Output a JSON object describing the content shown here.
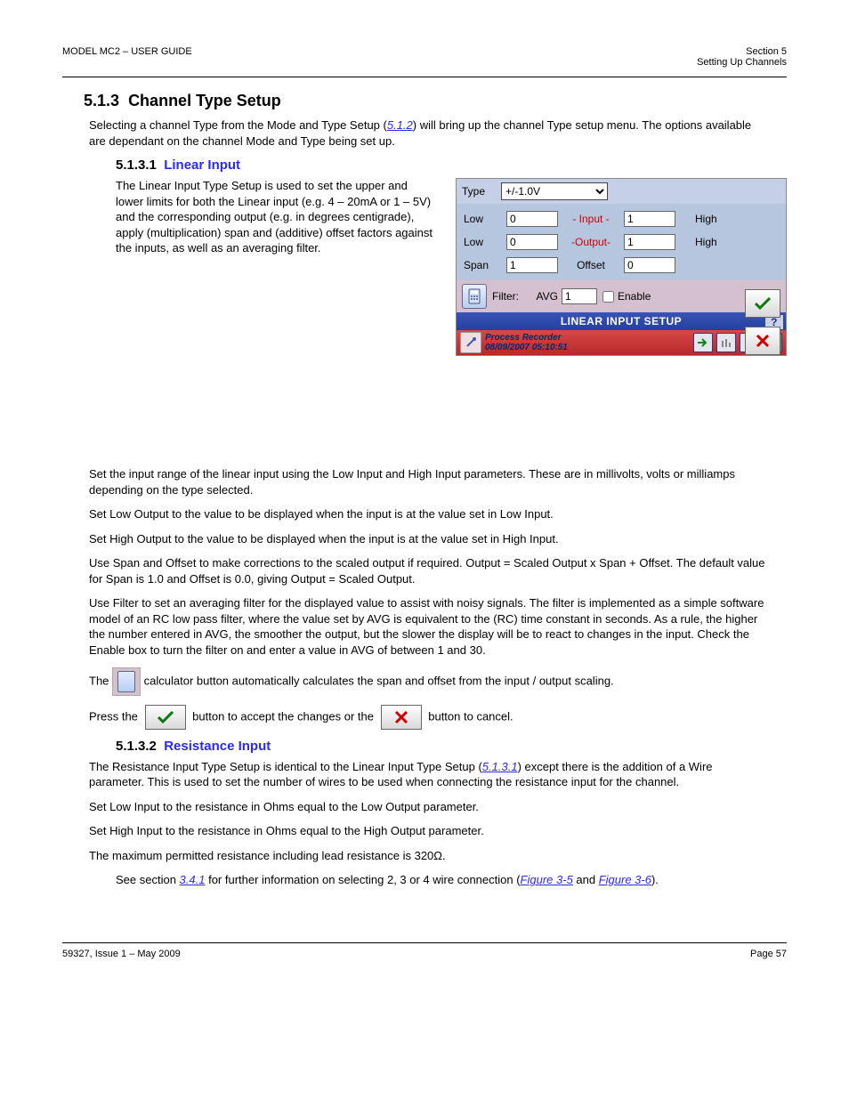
{
  "header": {
    "left": "MODEL MC2 – USER GUIDE",
    "right_line1": "Section 5",
    "right_line2": "Setting Up Channels"
  },
  "section": {
    "num": "5.1.3",
    "title": "Channel Type Setup"
  },
  "pretext": "Selecting a channel Type from the Mode and Type Setup (",
  "pretext_ref": "5.1.2",
  "pretext_after": ") will bring up the channel Type setup menu. The options available are dependant on the channel Mode and Type being set up.",
  "sub1": {
    "num": "5.1.3.1",
    "title": "Linear Input"
  },
  "linear_block": "The Linear Input Type Setup is used to set the upper and lower limits for both the Linear input (e.g. 4 – 20mA or 1 – 5V) and the corresponding output (e.g. in degrees centigrade), apply (multiplication) span and (additive) offset factors against the inputs, as well as an averaging filter.",
  "panel": {
    "type_label": "Type",
    "type_value": "+/-1.0V",
    "rows": [
      {
        "left": "Low",
        "v1": "0",
        "mid": "- Input -",
        "mid_red": true,
        "v2": "1",
        "right": "High"
      },
      {
        "left": "Low",
        "v1": "0",
        "mid": "-Output-",
        "mid_red": true,
        "v2": "1",
        "right": "High"
      },
      {
        "left": "Span",
        "v1": "1",
        "mid": "Offset",
        "mid_red": false,
        "v2": "0",
        "right": ""
      }
    ],
    "filter_label": "Filter:",
    "filter_avg_label": "AVG",
    "filter_avg_value": "1",
    "enable_label": "Enable",
    "title_bar": "LINEAR INPUT SETUP",
    "status": {
      "name": "Process Recorder",
      "ts": "08/09/2007 05:10:51"
    }
  },
  "after_panel_lines": [
    "Set the input range of the linear input using the Low Input and High Input parameters. These are in millivolts, volts or milliamps depending on the type selected.",
    "Set Low Output to the value to be displayed when the input is at the value set in Low Input.",
    "Set High Output to the value to be displayed when the input is at the value set in High Input.",
    "Use Span and Offset to make corrections to the scaled output if required. Output = Scaled Output x Span + Offset. The default value for Span is 1.0 and Offset is 0.0, giving Output = Scaled Output.",
    "Use Filter to set an averaging filter for the displayed value to assist with noisy signals. The filter is implemented as a simple software model of an RC low pass filter, where the value set by AVG is equivalent to the (RC) time constant in seconds. As a rule, the higher the number entered in AVG, the smoother the output, but the slower the display will be to react to changes in the input. Check the Enable box to turn the filter on and enter a value in AVG of between 1 and 30."
  ],
  "calc_line_before": "The ",
  "calc_line_after": " calculator button automatically calculates the span and offset from the input / output scaling.",
  "accept_line_before": "Press the",
  "accept_line_after": "button to accept the changes or the",
  "accept_line_tail": "button to cancel.",
  "sub2": {
    "num": "5.1.3.2",
    "title": "Resistance Input"
  },
  "res_body_1_before": "The Resistance Input Type Setup is identical to the Linear Input Type Setup (",
  "res_body_1_ref": "5.1.3.1",
  "res_body_1_after": ") except there is the addition of a Wire parameter. This is used to set the number of wires to be used when connecting the resistance input for the channel.",
  "res_body_2": "Set Low Input to the resistance in Ohms equal to the Low Output parameter.",
  "res_body_3": "Set High Input to the resistance in Ohms equal to the High Output parameter.",
  "res_body_4": "The maximum permitted resistance including lead resistance is 320Ω.",
  "res_body_5_before": "See section ",
  "res_body_5_ref": "3.4.1",
  "res_body_5_mid": " for further information on selecting 2, 3 or 4 wire connection (",
  "res_body_5_ref2": "Figure 3-5",
  "res_body_5_mid2": " and ",
  "res_body_5_ref3": "Figure 3-6",
  "res_body_5_after": ").",
  "footer": {
    "left": "59327, Issue 1 – May 2009",
    "right": "Page 57"
  }
}
